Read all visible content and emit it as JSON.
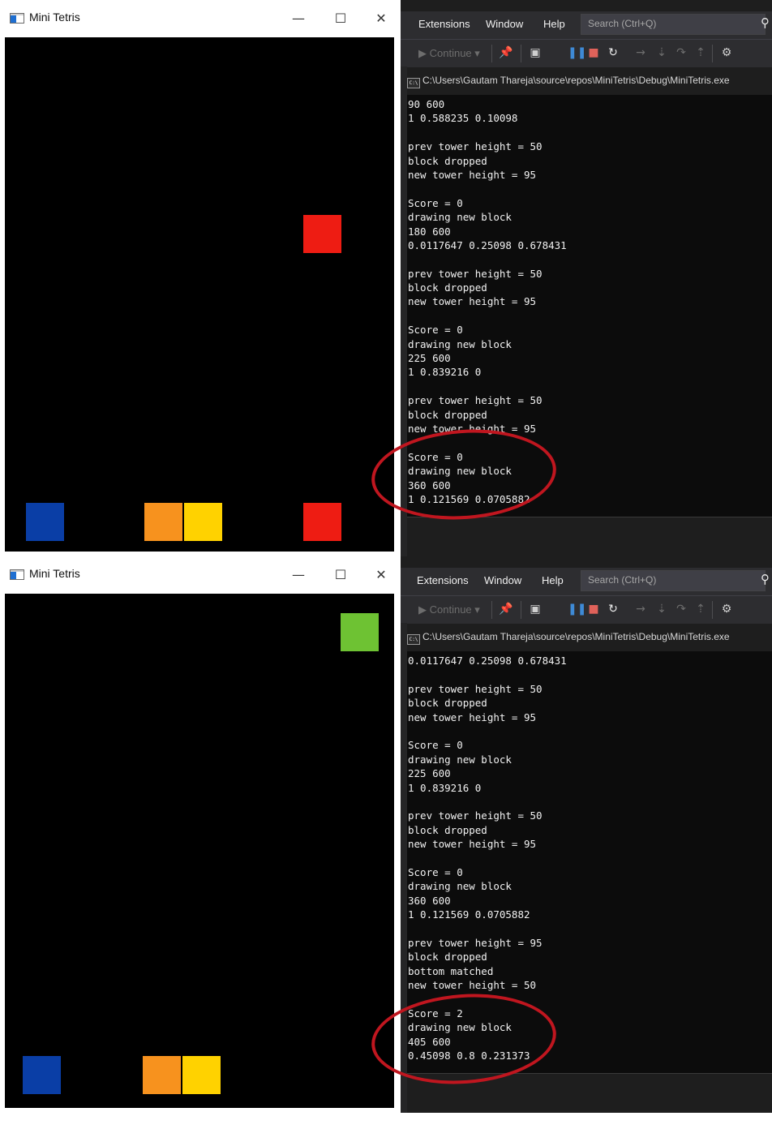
{
  "colors": {
    "blue": "#0a3ea6",
    "orange": "#f7921e",
    "yellow": "#ffd200",
    "red": "#ee1c13",
    "green": "#6ec233",
    "annotation_ring": "#c0161f"
  },
  "panels": [
    {
      "game_window": {
        "title": "Mini Tetris",
        "controls": {
          "minimize": "—",
          "maximize": "☐",
          "close": "✕"
        }
      },
      "ide": {
        "menu": [
          "Extensions",
          "Window",
          "Help"
        ],
        "search_placeholder": "Search (Ctrl+Q)",
        "toolbar": {
          "continue_label": "▶ Continue ▾"
        },
        "console_title": "C:\\Users\\Gautam Thareja\\source\\repos\\MiniTetris\\Debug\\MiniTetris.exe",
        "console_lines": [
          "90 600",
          "1 0.588235 0.10098",
          "",
          "prev tower height = 50",
          "block dropped",
          "new tower height = 95",
          "",
          "Score = 0",
          "drawing new block",
          "180 600",
          "0.0117647 0.25098 0.678431",
          "",
          "prev tower height = 50",
          "block dropped",
          "new tower height = 95",
          "",
          "Score = 0",
          "drawing new block",
          "225 600",
          "1 0.839216 0",
          "",
          "prev tower height = 50",
          "block dropped",
          "new tower height = 95",
          "",
          "Score = 0",
          "drawing new block",
          "360 600",
          "1 0.121569 0.0705882"
        ]
      }
    },
    {
      "game_window": {
        "title": "Mini Tetris",
        "controls": {
          "minimize": "—",
          "maximize": "☐",
          "close": "✕"
        }
      },
      "ide": {
        "menu": [
          "Extensions",
          "Window",
          "Help"
        ],
        "search_placeholder": "Search (Ctrl+Q)",
        "toolbar": {
          "continue_label": "▶ Continue ▾"
        },
        "console_title": "C:\\Users\\Gautam Thareja\\source\\repos\\MiniTetris\\Debug\\MiniTetris.exe",
        "console_lines": [
          "0.0117647 0.25098 0.678431",
          "",
          "prev tower height = 50",
          "block dropped",
          "new tower height = 95",
          "",
          "Score = 0",
          "drawing new block",
          "225 600",
          "1 0.839216 0",
          "",
          "prev tower height = 50",
          "block dropped",
          "new tower height = 95",
          "",
          "Score = 0",
          "drawing new block",
          "360 600",
          "1 0.121569 0.0705882",
          "",
          "prev tower height = 95",
          "block dropped",
          "bottom matched",
          "new tower height = 50",
          "",
          "Score = 2",
          "drawing new block",
          "405 600",
          "0.45098 0.8 0.231373"
        ]
      }
    }
  ]
}
